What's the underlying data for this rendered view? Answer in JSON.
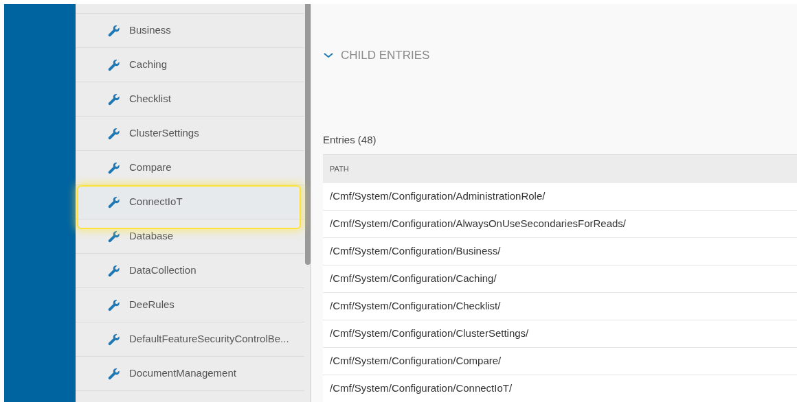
{
  "sidebar": {
    "items": [
      {
        "label": "Business",
        "selected": false
      },
      {
        "label": "Caching",
        "selected": false
      },
      {
        "label": "Checklist",
        "selected": false
      },
      {
        "label": "ClusterSettings",
        "selected": false
      },
      {
        "label": "Compare",
        "selected": false
      },
      {
        "label": "ConnectIoT",
        "selected": true
      },
      {
        "label": "Database",
        "selected": false
      },
      {
        "label": "DataCollection",
        "selected": false
      },
      {
        "label": "DeeRules",
        "selected": false
      },
      {
        "label": "DefaultFeatureSecurityControlBe...",
        "selected": false
      },
      {
        "label": "DocumentManagement",
        "selected": false
      }
    ]
  },
  "section": {
    "title": "CHILD ENTRIES",
    "expanded": true
  },
  "table": {
    "title": "Entries (48)",
    "columns": [
      "PATH"
    ],
    "rows": [
      [
        "/Cmf/System/Configuration/AdministrationRole/"
      ],
      [
        "/Cmf/System/Configuration/AlwaysOnUseSecondariesForReads/"
      ],
      [
        "/Cmf/System/Configuration/Business/"
      ],
      [
        "/Cmf/System/Configuration/Caching/"
      ],
      [
        "/Cmf/System/Configuration/Checklist/"
      ],
      [
        "/Cmf/System/Configuration/ClusterSettings/"
      ],
      [
        "/Cmf/System/Configuration/Compare/"
      ],
      [
        "/Cmf/System/Configuration/ConnectIoT/"
      ]
    ]
  }
}
